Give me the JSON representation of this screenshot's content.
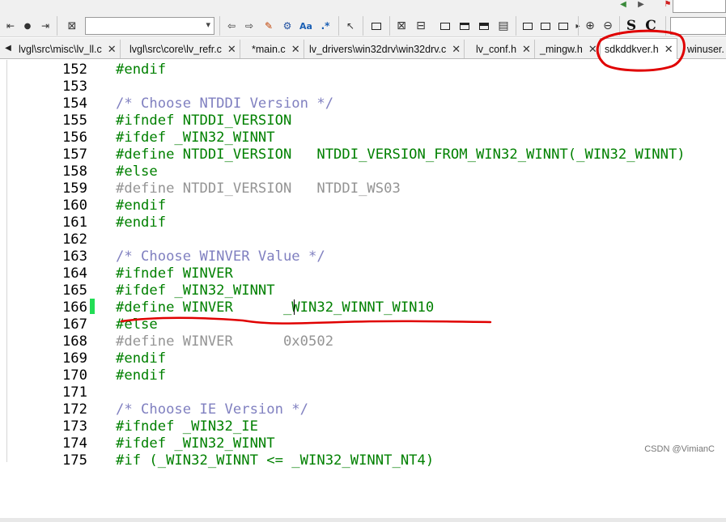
{
  "toolbar": {
    "combo_value": "",
    "combo_right_value": "",
    "bold_s_label": "S",
    "bold_c_label": "C",
    "aa_label": "Aa",
    "regex_label": ".*"
  },
  "tabs": [
    {
      "label": "lvgl\\src\\misc\\lv_ll.c"
    },
    {
      "label": "lvgl\\src\\core\\lv_refr.c"
    },
    {
      "label": "*main.c"
    },
    {
      "label": "lv_drivers\\win32drv\\win32drv.c"
    },
    {
      "label": "lv_conf.h"
    },
    {
      "label": "_mingw.h"
    },
    {
      "label": "sdkddkver.h"
    },
    {
      "label": "winuser."
    }
  ],
  "lines": [
    {
      "n": "152",
      "text": "#endif",
      "kind": "directive"
    },
    {
      "n": "153",
      "text": "",
      "kind": "directive"
    },
    {
      "n": "154",
      "text": "/* Choose NTDDI Version */",
      "kind": "comment"
    },
    {
      "n": "155",
      "text": "#ifndef NTDDI_VERSION",
      "kind": "directive"
    },
    {
      "n": "156",
      "text": "#ifdef _WIN32_WINNT",
      "kind": "directive"
    },
    {
      "n": "157",
      "text": "#define NTDDI_VERSION   NTDDI_VERSION_FROM_WIN32_WINNT(_WIN32_WINNT)",
      "kind": "directive"
    },
    {
      "n": "158",
      "text": "#else",
      "kind": "directive"
    },
    {
      "n": "159",
      "text": "#define NTDDI_VERSION   NTDDI_WS03",
      "kind": "inactive"
    },
    {
      "n": "160",
      "text": "#endif",
      "kind": "directive"
    },
    {
      "n": "161",
      "text": "#endif",
      "kind": "directive"
    },
    {
      "n": "162",
      "text": "",
      "kind": "directive"
    },
    {
      "n": "163",
      "text": "/* Choose WINVER Value */",
      "kind": "comment"
    },
    {
      "n": "164",
      "text": "#ifndef WINVER",
      "kind": "directive"
    },
    {
      "n": "165",
      "text": "#ifdef _WIN32_WINNT",
      "kind": "directive"
    },
    {
      "n": "166",
      "text": "#define WINVER      _WIN32_WINNT_WIN10",
      "kind": "directive"
    },
    {
      "n": "167",
      "text": "#else",
      "kind": "directive"
    },
    {
      "n": "168",
      "text": "#define WINVER      0x0502",
      "kind": "inactive"
    },
    {
      "n": "169",
      "text": "#endif",
      "kind": "directive"
    },
    {
      "n": "170",
      "text": "#endif",
      "kind": "directive"
    },
    {
      "n": "171",
      "text": "",
      "kind": "directive"
    },
    {
      "n": "172",
      "text": "/* Choose IE Version */",
      "kind": "comment"
    },
    {
      "n": "173",
      "text": "#ifndef _WIN32_IE",
      "kind": "directive"
    },
    {
      "n": "174",
      "text": "#ifdef _WIN32_WINNT",
      "kind": "directive"
    },
    {
      "n": "175",
      "text": "#if (_WIN32_WINNT <= _WIN32_WINNT_NT4)",
      "kind": "directive"
    }
  ],
  "watermark": "CSDN @VimianC",
  "colors": {
    "directive": "#008000",
    "comment": "#8080c0",
    "inactive": "#949494",
    "annotation": "#e00000",
    "change_marker": "#22dd55"
  },
  "icons": [
    "tab-left-icon",
    "record-icon",
    "play-icon",
    "macro-icon",
    "back-arrow-icon",
    "forward-arrow-icon",
    "highlighter-icon",
    "find-icon",
    "match-case-icon",
    "regex-icon",
    "select-arrow-icon",
    "rect-icon",
    "zoom-in-icon",
    "zoom-out-icon"
  ]
}
